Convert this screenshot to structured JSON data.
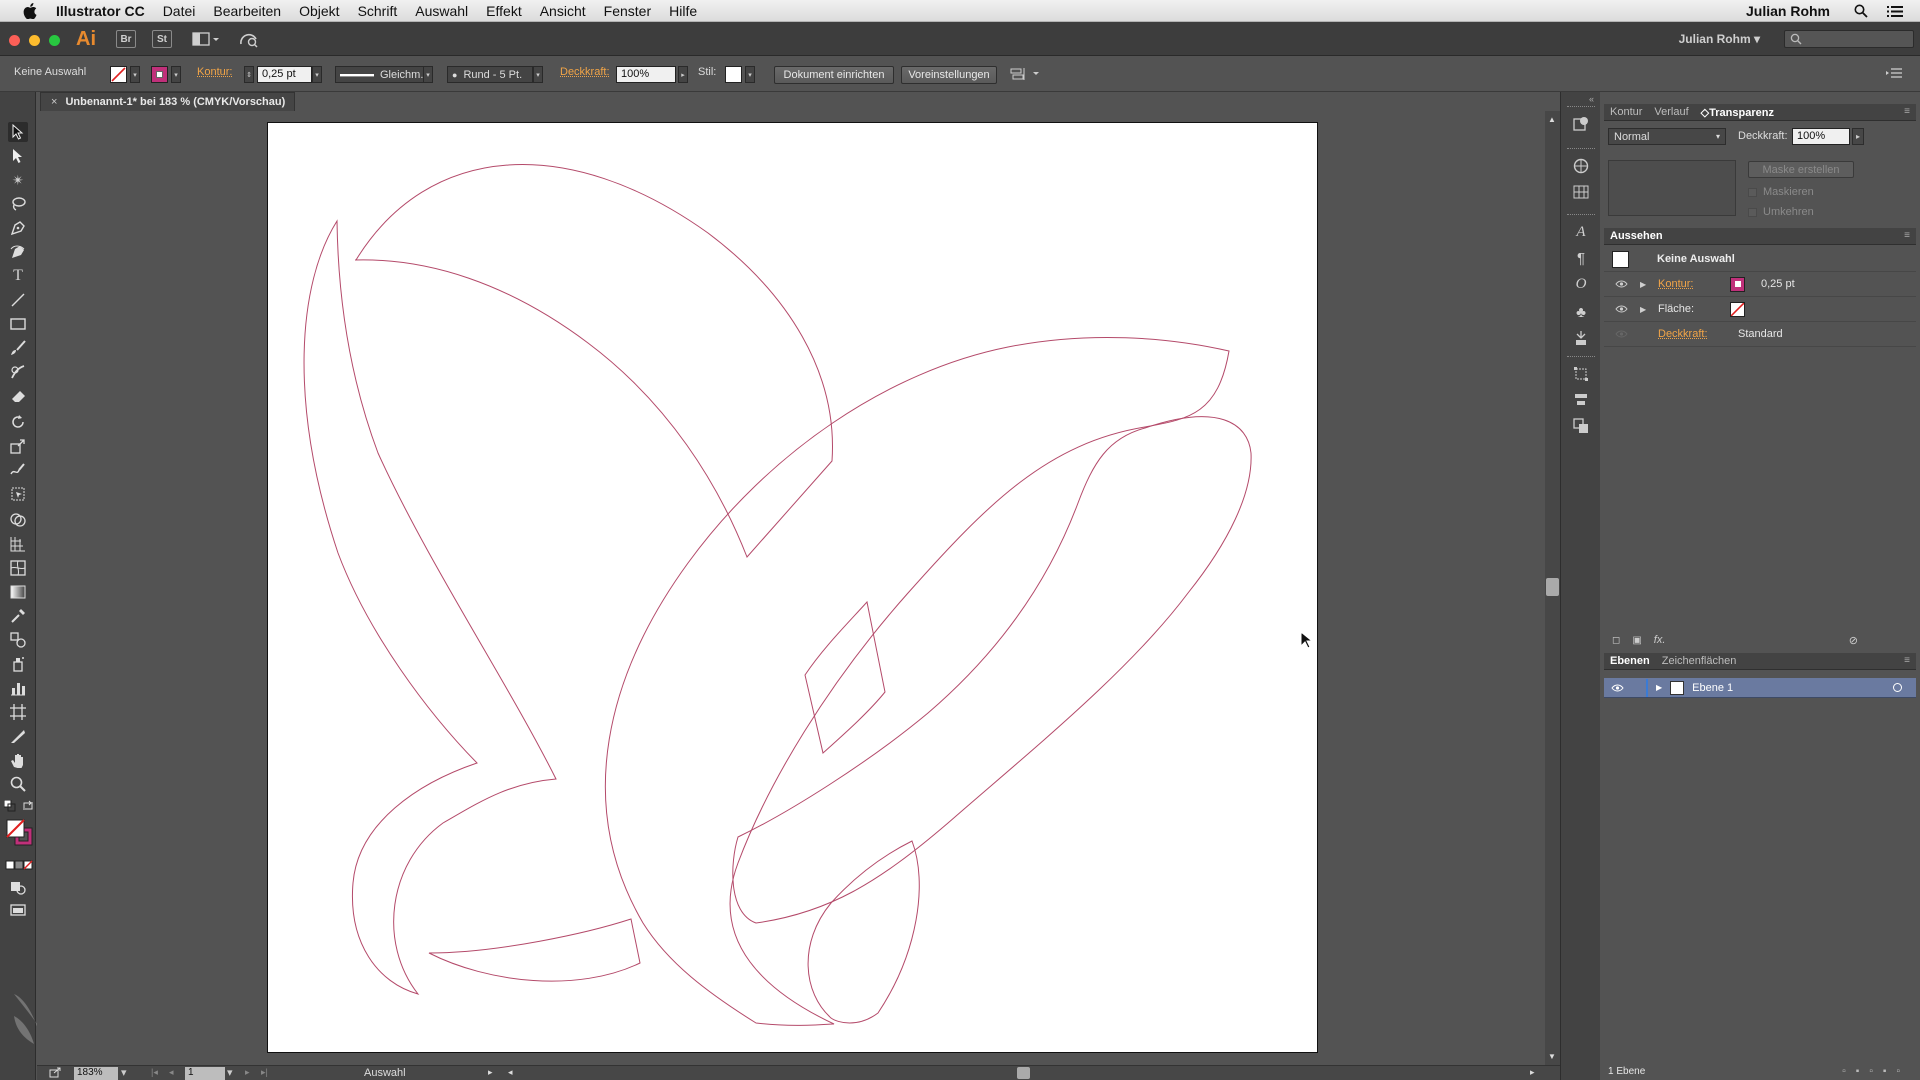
{
  "menubar": {
    "app_name": "Illustrator CC",
    "items": [
      "Datei",
      "Bearbeiten",
      "Objekt",
      "Schrift",
      "Auswahl",
      "Effekt",
      "Ansicht",
      "Fenster",
      "Hilfe"
    ],
    "user": "Julian Rohm"
  },
  "appbar": {
    "logo": "Ai",
    "bridge_label": "Br",
    "stock_label": "St",
    "workspace_user": "Julian Rohm"
  },
  "control": {
    "selection": "Keine Auswahl",
    "kontur_label": "Kontur:",
    "stroke_weight": "0,25 pt",
    "stroke_profile": "Gleichm.",
    "brush": "Rund - 5 Pt.",
    "opacity_label": "Deckkraft:",
    "opacity": "100%",
    "style_label": "Stil:",
    "doc_setup": "Dokument einrichten",
    "preferences": "Voreinstellungen"
  },
  "document": {
    "tab_title": "Unbenannt-1* bei 183 % (CMYK/Vorschau)",
    "zoom": "183%",
    "artboard_index": "1",
    "status_mode": "Auswahl"
  },
  "transparency_panel": {
    "tabs": [
      "Kontur",
      "Verlauf",
      "Transparenz"
    ],
    "active_tab": "Transparenz",
    "blend_mode": "Normal",
    "opacity_label": "Deckkraft:",
    "opacity": "100%",
    "make_mask": "Maske erstellen",
    "clip": "Maskieren",
    "invert": "Umkehren"
  },
  "appearance_panel": {
    "title": "Aussehen",
    "target": "Keine Auswahl",
    "stroke_label": "Kontur:",
    "stroke_value": "0,25 pt",
    "fill_label": "Fläche:",
    "opacity_label": "Deckkraft:",
    "opacity_value": "Standard",
    "fx_label": "fx."
  },
  "layers_panel": {
    "tabs": [
      "Ebenen",
      "Zeichenflächen"
    ],
    "active_tab": "Ebenen",
    "layer_name": "Ebene 1",
    "layer_count": "1 Ebene"
  },
  "colors": {
    "accent_orange": "#f1a447",
    "stroke_magenta": "#c0307a",
    "outline": "#b44a6a",
    "layer_highlight": "#6a7aa0"
  },
  "icons": {
    "tools": [
      "selection-tool",
      "direct-selection-tool",
      "magic-wand-tool",
      "lasso-tool",
      "pen-tool",
      "curvature-tool",
      "type-tool",
      "line-tool",
      "rectangle-tool",
      "paintbrush-tool",
      "shaper-tool",
      "eraser-tool",
      "rotate-tool",
      "scale-tool",
      "warp-tool",
      "free-transform-tool",
      "shape-builder-tool",
      "perspective-grid-tool",
      "mesh-tool",
      "gradient-tool",
      "eyedropper-tool",
      "blend-tool",
      "symbol-sprayer-tool",
      "column-graph-tool",
      "artboard-tool",
      "slice-tool",
      "hand-tool",
      "zoom-tool"
    ]
  }
}
